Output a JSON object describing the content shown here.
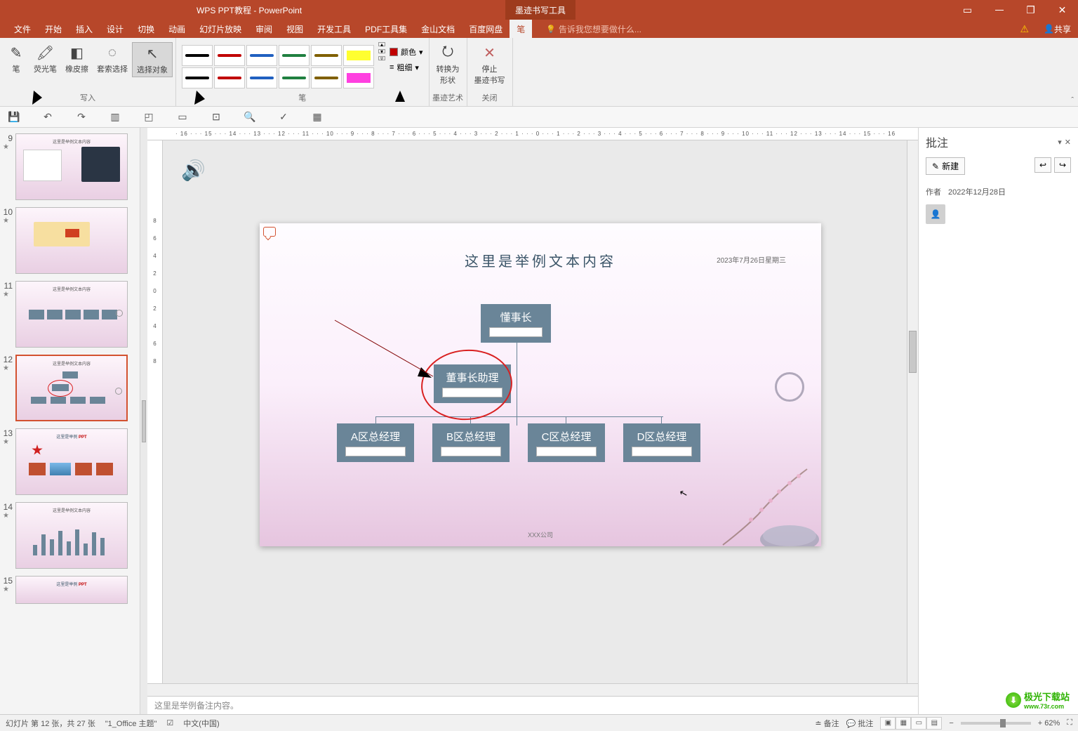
{
  "titlebar": {
    "title": "WPS PPT教程 - PowerPoint",
    "context_tab": "墨迹书写工具"
  },
  "menubar": {
    "items": [
      "文件",
      "开始",
      "插入",
      "设计",
      "切换",
      "动画",
      "幻灯片放映",
      "审阅",
      "视图",
      "开发工具",
      "PDF工具集",
      "金山文档",
      "百度网盘",
      "笔"
    ],
    "active_index": 13,
    "tell_me": "告诉我您想要做什么...",
    "share": "共享"
  },
  "ribbon": {
    "group_write": "写入",
    "group_pen": "笔",
    "group_ink_art": "墨迹艺术",
    "group_close": "关闭",
    "btn_pen": "笔",
    "btn_highlighter": "荧光笔",
    "btn_eraser": "橡皮擦",
    "btn_lasso": "套索选择",
    "btn_select": "选择对象",
    "btn_color": "颜色",
    "btn_thickness": "粗细",
    "btn_convert": "转换为\n形状",
    "btn_stop": "停止\n墨迹书写",
    "pen_colors_row1": [
      "#000000",
      "#c00000",
      "#2060c0",
      "#208040",
      "#806000",
      "#ffff40"
    ],
    "pen_colors_row2": [
      "#000000",
      "#c00000",
      "#2060c0",
      "#208040",
      "#806000",
      "#40ff40"
    ],
    "pen_hl_row1": "#40d0ff",
    "pen_hl_row2": "#ff40e0"
  },
  "slide_panel": {
    "slides": [
      {
        "num": "9"
      },
      {
        "num": "10"
      },
      {
        "num": "11"
      },
      {
        "num": "12",
        "active": true
      },
      {
        "num": "13"
      },
      {
        "num": "14"
      },
      {
        "num": "15"
      }
    ]
  },
  "canvas": {
    "title": "这里是举例文本内容",
    "date": "2023年7月26日星期三",
    "footer": "XXX公司",
    "nodes": {
      "n1": "懂事长",
      "n2": "董事长助理",
      "n3": "A区总经理",
      "n4": "B区总经理",
      "n5": "C区总经理",
      "n6": "D区总经理"
    }
  },
  "notes": {
    "placeholder": "这里是举例备注内容。"
  },
  "comments": {
    "title": "批注",
    "new": "新建",
    "author_label": "作者",
    "date": "2022年12月28日"
  },
  "statusbar": {
    "slide_info": "幻灯片 第 12 张，共 27 张",
    "theme": "\"1_Office 主题\"",
    "lang": "中文(中国)",
    "notes_btn": "备注",
    "comments_btn": "批注",
    "zoom": "+ 62%"
  },
  "ruler_h": "· 16 · · · 15 · · · 14 · · · 13 · · · 12 · · · 11 · · · 10 · · · 9 · · · 8 · · · 7 · · · 6 · · · 5 · · · 4 · · · 3 · · · 2 · · · 1 · · · 0 · · · 1 · · · 2 · · · 3 · · · 4 · · · 5 · · · 6 · · · 7 · · · 8 · · · 9 · · · 10 · · · 11 · · · 12 · · · 13 · · · 14 · · · 15 · · · 16",
  "ruler_v": [
    "8",
    "6",
    "4",
    "2",
    "0",
    "2",
    "4",
    "6",
    "8"
  ],
  "watermark": {
    "name": "极光下载站",
    "url": "www.73r.com"
  }
}
